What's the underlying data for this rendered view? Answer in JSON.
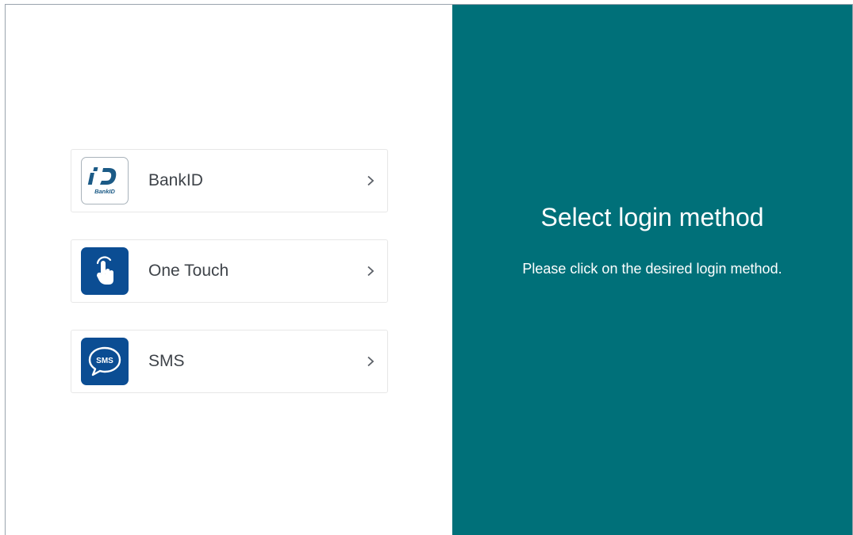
{
  "colors": {
    "panel_background": "#007079",
    "brand_blue": "#0b4d93",
    "bankid_icon": "#1b5a86",
    "text_primary": "#3e4349",
    "panel_text": "#ffffff"
  },
  "login_methods": [
    {
      "label": "BankID",
      "icon": "bankid-icon",
      "icon_caption": "BankID"
    },
    {
      "label": "One Touch",
      "icon": "touch-hand-icon"
    },
    {
      "label": "SMS",
      "icon": "sms-bubble-icon",
      "icon_caption": "SMS"
    }
  ],
  "panel": {
    "title": "Select login method",
    "subtitle": "Please click on the desired login method."
  }
}
